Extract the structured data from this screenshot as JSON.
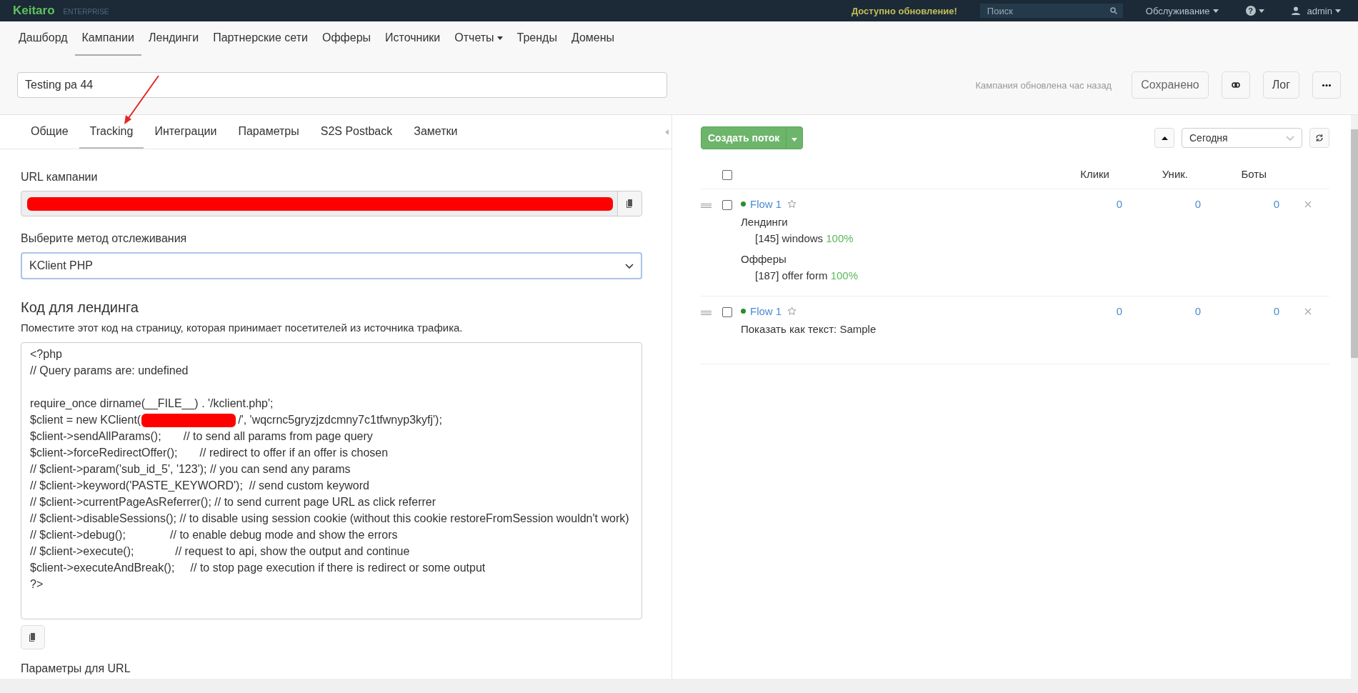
{
  "topbar": {
    "logo": "Keitaro",
    "edition": "ENTERPRISE",
    "update_notice": "Доступно обновление!",
    "search": {
      "placeholder": "Поиск"
    },
    "service_menu": "Обслуживание",
    "help_menu": "?",
    "user_menu": "admin"
  },
  "nav": [
    {
      "label": "Дашборд",
      "selected": false,
      "dropdown": false
    },
    {
      "label": "Кампании",
      "selected": true,
      "dropdown": false
    },
    {
      "label": "Лендинги",
      "selected": false,
      "dropdown": false
    },
    {
      "label": "Партнерские сети",
      "selected": false,
      "dropdown": false
    },
    {
      "label": "Офферы",
      "selected": false,
      "dropdown": false
    },
    {
      "label": "Источники",
      "selected": false,
      "dropdown": false
    },
    {
      "label": "Отчеты",
      "selected": false,
      "dropdown": true
    },
    {
      "label": "Тренды",
      "selected": false,
      "dropdown": false
    },
    {
      "label": "Домены",
      "selected": false,
      "dropdown": false
    }
  ],
  "campaign": {
    "name": "Testing pa 44",
    "status": "Кампания обновлена час назад",
    "save_button": "Сохранено",
    "log_button": "Лог"
  },
  "tabs": [
    {
      "label": "Общие",
      "selected": false
    },
    {
      "label": "Tracking",
      "selected": true
    },
    {
      "label": "Интеграции",
      "selected": false
    },
    {
      "label": "Параметры",
      "selected": false
    },
    {
      "label": "S2S Postback",
      "selected": false
    },
    {
      "label": "Заметки",
      "selected": false
    }
  ],
  "tracking": {
    "url_label": "URL кампании",
    "method_label": "Выберите метод отслеживания",
    "method": "KClient PHP",
    "code_title": "Код для лендинга",
    "code_hint": "Поместите этот код на страницу, которая принимает посетителей из источника трафика.",
    "params_label": "Параметры для URL",
    "code_blocks": [
      [
        {
          "kind": "text",
          "text": "<?php"
        },
        {
          "kind": "text",
          "text": "// Query params are: undefined"
        }
      ],
      [
        {
          "kind": "text",
          "text": "require_once dirname(__FILE__) . '/kclient.php';"
        },
        {
          "kind": "redacted",
          "before": "$client = new KClient(",
          "after": "/', 'wqcrnc5gryzjzdcmny7c1tfwnyp3kyfj');"
        },
        {
          "kind": "text",
          "text": "$client->sendAllParams();       // to send all params from page query"
        },
        {
          "kind": "text",
          "text": "$client->forceRedirectOffer();       // redirect to offer if an offer is chosen"
        },
        {
          "kind": "text",
          "text": "// $client->param('sub_id_5', '123'); // you can send any params"
        },
        {
          "kind": "text",
          "text": "// $client->keyword('PASTE_KEYWORD');  // send custom keyword"
        },
        {
          "kind": "text",
          "text": "// $client->currentPageAsReferrer(); // to send current page URL as click referrer"
        },
        {
          "kind": "text",
          "text": "// $client->disableSessions(); // to disable using session cookie (without this cookie restoreFromSession wouldn't work)"
        },
        {
          "kind": "text",
          "text": "// $client->debug();              // to enable debug mode and show the errors"
        },
        {
          "kind": "text",
          "text": "// $client->execute();             // request to api, show the output and continue"
        },
        {
          "kind": "text",
          "text": "$client->executeAndBreak();     // to stop page execution if there is redirect or some output"
        },
        {
          "kind": "text",
          "text": "?>"
        }
      ]
    ]
  },
  "flows": {
    "create_button": "Создать поток",
    "period": "Сегодня",
    "all_checked": false,
    "columns": [
      "Клики",
      "Уник.",
      "Боты"
    ],
    "rows": [
      {
        "kind": "distribution",
        "name": "Flow 1",
        "checked": false,
        "starred": false,
        "values": [
          "0",
          "0",
          "0"
        ],
        "groups": [
          {
            "title": "Лендинги",
            "items": [
              {
                "name": "[145] windows",
                "share": "100%"
              }
            ]
          },
          {
            "title": "Офферы",
            "items": [
              {
                "name": "[187] offer form",
                "share": "100%"
              }
            ]
          }
        ]
      },
      {
        "kind": "text",
        "name": "Flow 1",
        "checked": false,
        "starred": false,
        "values": [
          "0",
          "0",
          "0"
        ],
        "text": "Показать как текст: Sample"
      }
    ]
  }
}
